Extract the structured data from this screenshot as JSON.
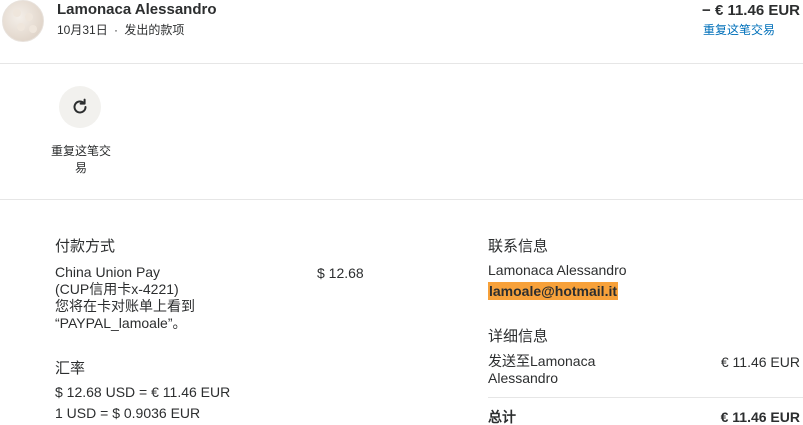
{
  "header": {
    "name": "Lamonaca Alessandro",
    "date": "10月31日",
    "separator": "·",
    "type": "发出的款项",
    "amount": "− € 11.46 EUR",
    "repeat_link": "重复这笔交易"
  },
  "actions": {
    "repeat_label": "重复这笔交易",
    "repeat_icon": "refresh-icon"
  },
  "payment": {
    "heading": "付款方式",
    "method_line1": "China Union Pay",
    "method_line2": "(CUP信用卡x-4221)",
    "method_line3": "您将在卡对账单上看到",
    "method_line4": "“PAYPAL_lamoale”。",
    "amount": "$ 12.68"
  },
  "exchange": {
    "heading": "汇率",
    "line1": "$ 12.68 USD = € 11.46 EUR",
    "line2": "1 USD = $ 0.9036 EUR"
  },
  "contact": {
    "heading": "联系信息",
    "name": "Lamonaca Alessandro",
    "email": "lamoale@hotmail.it",
    "email_highlight_color": "#f7a13a"
  },
  "details": {
    "heading": "详细信息",
    "sent_to_line1": "发送至Lamonaca",
    "sent_to_line2": "Alessandro",
    "sent_amount": "€ 11.46 EUR",
    "total_label": "总计",
    "total_amount": "€ 11.46 EUR"
  },
  "colors": {
    "link": "#0070ba",
    "text": "#2c2e2f",
    "divider": "#e6e6e6"
  }
}
